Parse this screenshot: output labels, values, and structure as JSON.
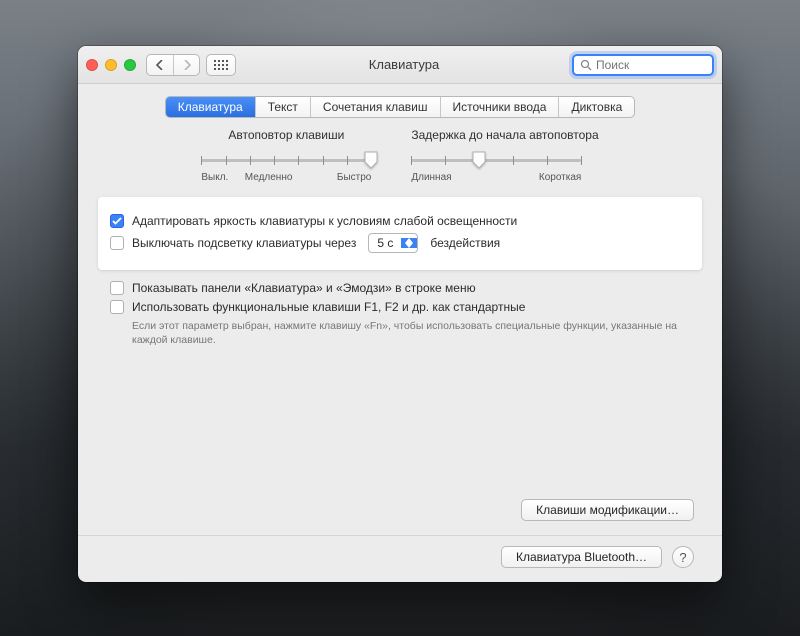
{
  "window": {
    "title": "Клавиатура"
  },
  "search": {
    "placeholder": "Поиск"
  },
  "tabs": [
    {
      "label": "Клавиатура",
      "active": true
    },
    {
      "label": "Текст"
    },
    {
      "label": "Сочетания клавиш"
    },
    {
      "label": "Источники ввода"
    },
    {
      "label": "Диктовка"
    }
  ],
  "sliders": {
    "repeat": {
      "title": "Автоповтор клавиши",
      "labels": {
        "left": "Выкл.",
        "mid": "Медленно",
        "right": "Быстро"
      },
      "ticks": 8,
      "value_index": 7
    },
    "delay": {
      "title": "Задержка до начала автоповтора",
      "labels": {
        "left": "Длинная",
        "right": "Короткая"
      },
      "ticks": 6,
      "value_index": 2
    }
  },
  "options": {
    "adjust_brightness": {
      "checked": true,
      "label": "Адаптировать яркость клавиатуры к условиям слабой освещенности"
    },
    "backlight_off": {
      "checked": false,
      "label_before": "Выключать подсветку клавиатуры через",
      "timeout_value": "5 с",
      "label_after": "бездействия"
    },
    "show_viewers": {
      "checked": false,
      "label": "Показывать панели «Клавиатура» и «Эмодзи» в строке меню"
    },
    "fn_standard": {
      "checked": false,
      "label": "Использовать функциональные клавиши F1, F2 и др. как стандартные",
      "hint": "Если этот параметр выбран, нажмите клавишу «Fn», чтобы использовать специальные функции, указанные на каждой клавише."
    }
  },
  "buttons": {
    "modifier_keys": "Клавиши модификации…",
    "bluetooth_kbd": "Клавиатура Bluetooth…",
    "help": "?"
  }
}
